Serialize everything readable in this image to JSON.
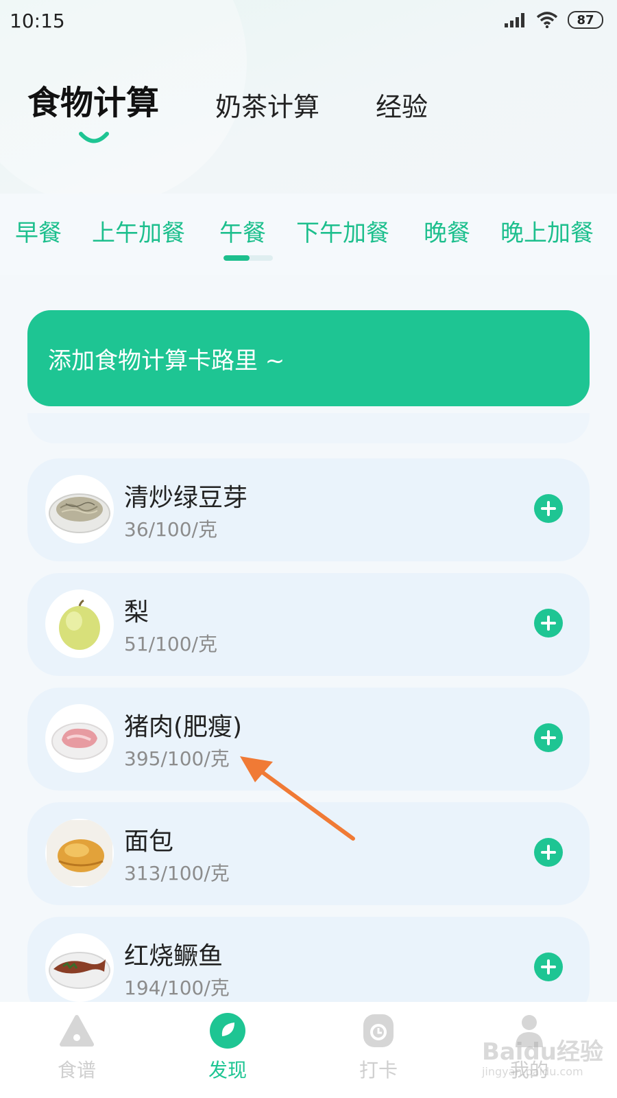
{
  "status": {
    "time": "10:15",
    "battery": "87",
    "signal_icon": "signal-icon",
    "wifi_icon": "wifi-icon"
  },
  "header": {
    "tabs": [
      {
        "label": "食物计算",
        "active": true
      },
      {
        "label": "奶茶计算",
        "active": false
      },
      {
        "label": "经验",
        "active": false
      }
    ]
  },
  "meals": {
    "tabs": [
      "早餐",
      "上午加餐",
      "午餐",
      "下午加餐",
      "晚餐",
      "晚上加餐"
    ],
    "active_index": 2
  },
  "cta": {
    "label": "添加食物计算卡路里 ~"
  },
  "foods": [
    {
      "name": "清炒绿豆芽",
      "calories": "36/100/克",
      "image": "bean-sprouts-image"
    },
    {
      "name": "梨",
      "calories": "51/100/克",
      "image": "pear-image"
    },
    {
      "name": "猪肉(肥瘦)",
      "calories": "395/100/克",
      "image": "pork-image"
    },
    {
      "name": "面包",
      "calories": "313/100/克",
      "image": "bread-image"
    },
    {
      "name": "红烧鳜鱼",
      "calories": "194/100/克",
      "image": "braised-fish-image"
    }
  ],
  "bottom_nav": [
    {
      "label": "食谱",
      "icon": "recipe-icon",
      "active": false
    },
    {
      "label": "发现",
      "icon": "discover-icon",
      "active": true
    },
    {
      "label": "打卡",
      "icon": "checkin-icon",
      "active": false
    },
    {
      "label": "我的",
      "icon": "profile-icon",
      "active": false
    }
  ],
  "watermark": {
    "brand": "Baidu经验",
    "url": "jingyan.baidu.com"
  },
  "colors": {
    "accent": "#1ec593",
    "card": "#eaf3fb",
    "annotation_arrow": "#f07a35"
  }
}
